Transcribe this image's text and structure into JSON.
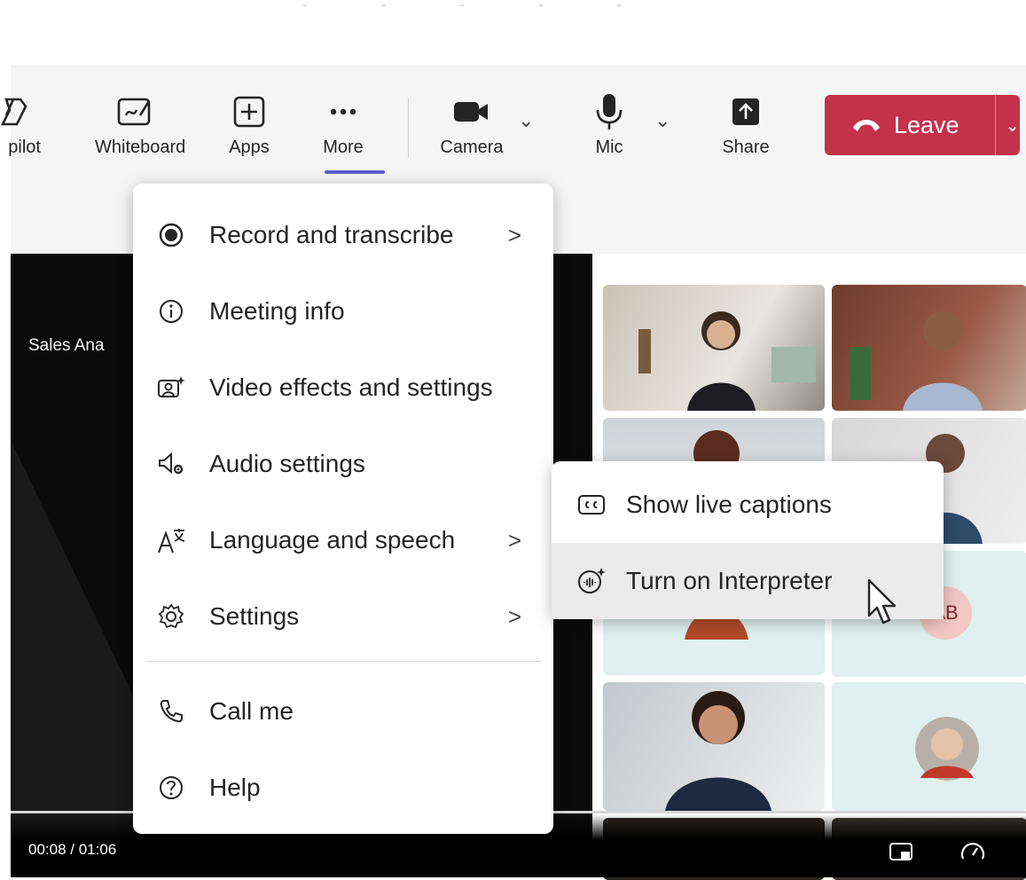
{
  "toolbar": {
    "items": [
      {
        "label": "pilot",
        "icon": "copilot-icon"
      },
      {
        "label": "Whiteboard",
        "icon": "whiteboard-icon"
      },
      {
        "label": "Apps",
        "icon": "apps-icon"
      },
      {
        "label": "More",
        "icon": "more-icon"
      },
      {
        "label": "Camera",
        "icon": "camera-icon"
      },
      {
        "label": "Mic",
        "icon": "mic-icon"
      },
      {
        "label": "Share",
        "icon": "share-icon"
      }
    ],
    "leave_label": "Leave"
  },
  "stage": {
    "title": "Sales Ana"
  },
  "more_menu": {
    "items": [
      {
        "label": "Record and transcribe",
        "icon": "record-icon",
        "has_submenu": true
      },
      {
        "label": "Meeting info",
        "icon": "info-icon",
        "has_submenu": false
      },
      {
        "label": "Video effects and settings",
        "icon": "video-effects-icon",
        "has_submenu": false
      },
      {
        "label": "Audio settings",
        "icon": "audio-settings-icon",
        "has_submenu": false
      },
      {
        "label": "Language and speech",
        "icon": "language-icon",
        "has_submenu": true
      },
      {
        "label": "Settings",
        "icon": "gear-icon",
        "has_submenu": true
      },
      {
        "label": "Call me",
        "icon": "phone-icon",
        "has_submenu": false
      },
      {
        "label": "Help",
        "icon": "help-icon",
        "has_submenu": false
      }
    ]
  },
  "language_submenu": {
    "items": [
      {
        "label": "Show live captions",
        "icon": "captions-icon"
      },
      {
        "label": "Turn on Interpreter",
        "icon": "interpreter-icon"
      }
    ]
  },
  "participants": {
    "avatar_initials": "AB"
  },
  "player": {
    "time": "00:08 / 01:06"
  },
  "colors": {
    "accent": "#5b5fc7",
    "leave": "#c4314b",
    "stage": "#0b0b0b",
    "tile_mint": "#dff0ee"
  }
}
